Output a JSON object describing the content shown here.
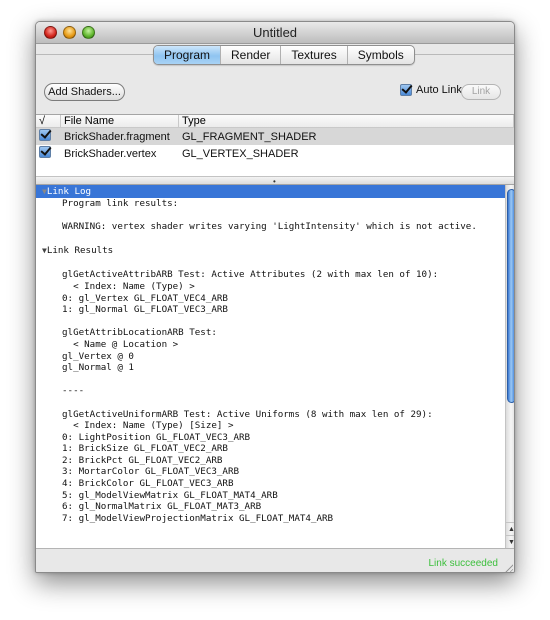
{
  "window": {
    "title": "Untitled",
    "buttons": {
      "close": "close-button",
      "minimize": "minimize-button",
      "zoom": "zoom-button"
    }
  },
  "tabs": [
    {
      "label": "Program",
      "active": true
    },
    {
      "label": "Render",
      "active": false
    },
    {
      "label": "Textures",
      "active": false
    },
    {
      "label": "Symbols",
      "active": false
    }
  ],
  "toolbar": {
    "add_shaders_label": "Add Shaders...",
    "auto_link_label": "Auto Link",
    "auto_link_checked": true,
    "link_label": "Link"
  },
  "file_table": {
    "headers": {
      "check": "√",
      "name": "File Name",
      "type": "Type"
    },
    "rows": [
      {
        "checked": true,
        "name": "BrickShader.fragment",
        "type": "GL_FRAGMENT_SHADER",
        "selected": true
      },
      {
        "checked": true,
        "name": "BrickShader.vertex",
        "type": "GL_VERTEX_SHADER",
        "selected": false
      }
    ]
  },
  "log": {
    "sections": [
      {
        "title": "Link Log",
        "highlighted": true,
        "text": "Program link results:\n\nWARNING: vertex shader writes varying 'LightIntensity' which is not active.\n\n"
      },
      {
        "title": "Link Results",
        "highlighted": false,
        "text": "glGetActiveAttribARB Test: Active Attributes (2 with max len of 10):\n  < Index: Name (Type) >\n0: gl_Vertex GL_FLOAT_VEC4_ARB\n1: gl_Normal GL_FLOAT_VEC3_ARB\n\nglGetAttribLocationARB Test:\n  < Name @ Location >\ngl_Vertex @ 0\ngl_Normal @ 1\n\n----\n\nglGetActiveUniformARB Test: Active Uniforms (8 with max len of 29):\n  < Index: Name (Type) [Size] >\n0: LightPosition GL_FLOAT_VEC3_ARB\n1: BrickSize GL_FLOAT_VEC2_ARB\n2: BrickPct GL_FLOAT_VEC2_ARB\n3: MortarColor GL_FLOAT_VEC3_ARB\n4: BrickColor GL_FLOAT_VEC3_ARB\n5: gl_ModelViewMatrix GL_FLOAT_MAT4_ARB\n6: gl_NormalMatrix GL_FLOAT_MAT3_ARB\n7: gl_ModelViewProjectionMatrix GL_FLOAT_MAT4_ARB"
      }
    ]
  },
  "status": {
    "text": "Link succeeded",
    "color": "#3cbf3c"
  },
  "icons": {
    "disclosure": "▼",
    "scroll_up": "▲",
    "scroll_down": "▼",
    "splitter": "•"
  }
}
